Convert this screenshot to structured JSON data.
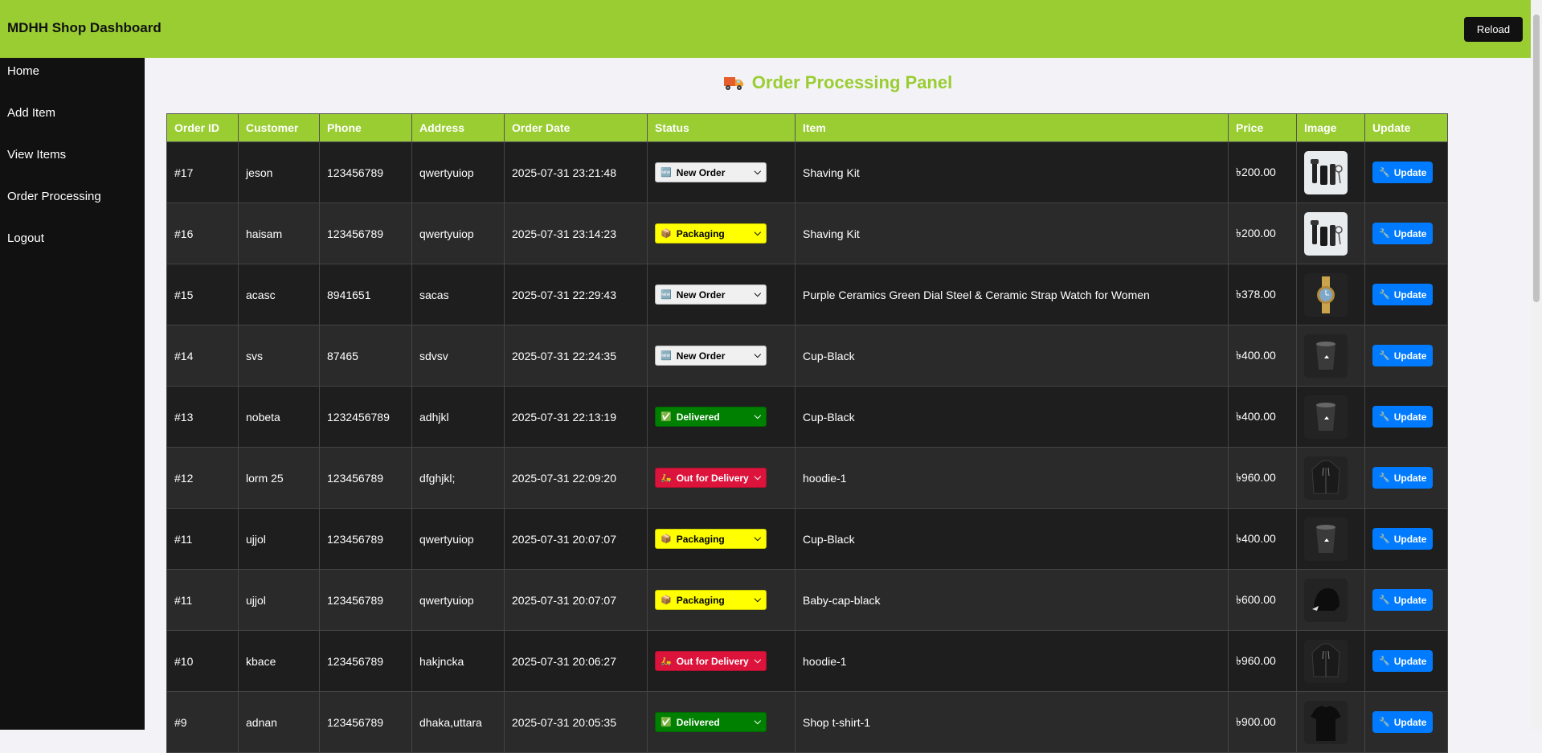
{
  "header": {
    "title": "MDHH Shop Dashboard",
    "reload_label": "Reload"
  },
  "sidebar": {
    "items": [
      {
        "label": "Home"
      },
      {
        "label": "Add Item"
      },
      {
        "label": "View Items"
      },
      {
        "label": "Order Processing"
      },
      {
        "label": "Logout"
      }
    ]
  },
  "panel": {
    "title": "Order Processing Panel",
    "icon": "truck-icon"
  },
  "table": {
    "columns": [
      "Order ID",
      "Customer",
      "Phone",
      "Address",
      "Order Date",
      "Status",
      "Item",
      "Price",
      "Image",
      "Update"
    ],
    "update_label": "Update",
    "rows": [
      {
        "id": "#17",
        "customer": "jeson",
        "phone": "123456789",
        "address": "qwertyuiop",
        "date": "2025-07-31 23:21:48",
        "status": "New Order",
        "status_icon": "🆕",
        "item": "Shaving Kit",
        "price": "৳200.00",
        "image": "shaving-kit-image"
      },
      {
        "id": "#16",
        "customer": "haisam",
        "phone": "123456789",
        "address": "qwertyuiop",
        "date": "2025-07-31 23:14:23",
        "status": "Packaging",
        "status_icon": "📦",
        "item": "Shaving Kit",
        "price": "৳200.00",
        "image": "shaving-kit-image"
      },
      {
        "id": "#15",
        "customer": "acasc",
        "phone": "8941651",
        "address": "sacas",
        "date": "2025-07-31 22:29:43",
        "status": "New Order",
        "status_icon": "🆕",
        "item": "Purple Ceramics Green Dial Steel & Ceramic Strap Watch for Women",
        "price": "৳378.00",
        "image": "watch-image"
      },
      {
        "id": "#14",
        "customer": "svs",
        "phone": "87465",
        "address": "sdvsv",
        "date": "2025-07-31 22:24:35",
        "status": "New Order",
        "status_icon": "🆕",
        "item": "Cup-Black",
        "price": "৳400.00",
        "image": "cup-image"
      },
      {
        "id": "#13",
        "customer": "nobeta",
        "phone": "1232456789",
        "address": "adhjkl",
        "date": "2025-07-31 22:13:19",
        "status": "Delivered",
        "status_icon": "✅",
        "item": "Cup-Black",
        "price": "৳400.00",
        "image": "cup-image"
      },
      {
        "id": "#12",
        "customer": "lorm 25",
        "phone": "123456789",
        "address": "dfghjkl;",
        "date": "2025-07-31 22:09:20",
        "status": "Out for Delivery",
        "status_icon": "🛵",
        "item": "hoodie-1",
        "price": "৳960.00",
        "image": "hoodie-image"
      },
      {
        "id": "#11",
        "customer": "ujjol",
        "phone": "123456789",
        "address": "qwertyuiop",
        "date": "2025-07-31 20:07:07",
        "status": "Packaging",
        "status_icon": "📦",
        "item": "Cup-Black",
        "price": "৳400.00",
        "image": "cup-image"
      },
      {
        "id": "#11",
        "customer": "ujjol",
        "phone": "123456789",
        "address": "qwertyuiop",
        "date": "2025-07-31 20:07:07",
        "status": "Packaging",
        "status_icon": "📦",
        "item": "Baby-cap-black",
        "price": "৳600.00",
        "image": "cap-image"
      },
      {
        "id": "#10",
        "customer": "kbace",
        "phone": "123456789",
        "address": "hakjncka",
        "date": "2025-07-31 20:06:27",
        "status": "Out for Delivery",
        "status_icon": "🛵",
        "item": "hoodie-1",
        "price": "৳960.00",
        "image": "hoodie-image"
      },
      {
        "id": "#9",
        "customer": "adnan",
        "phone": "123456789",
        "address": "dhaka,uttara",
        "date": "2025-07-31 20:05:35",
        "status": "Delivered",
        "status_icon": "✅",
        "item": "Shop t-shirt-1",
        "price": "৳900.00",
        "image": "tshirt-image"
      }
    ]
  },
  "colors": {
    "topbar": "#9acd32",
    "sidebar": "#111111",
    "new_order": "#f0f0f0",
    "packaging": "#ffff00",
    "delivered": "#008000",
    "out_for_delivery": "#dc143c",
    "update_button": "#007bff"
  }
}
